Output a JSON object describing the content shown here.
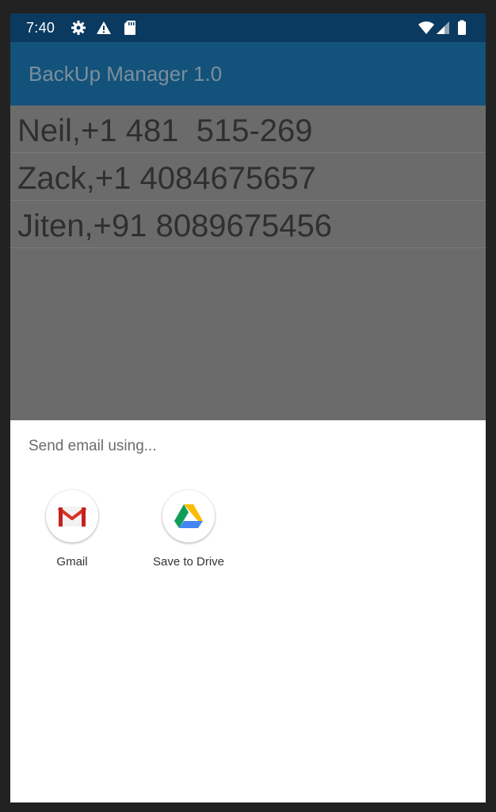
{
  "status_bar": {
    "time": "7:40",
    "icons_left": [
      "settings-gear-icon",
      "warning-icon",
      "sd-card-icon"
    ],
    "icons_right": [
      "wifi-icon",
      "cell-signal-icon",
      "battery-icon"
    ],
    "background": "#0a3a60"
  },
  "app_bar": {
    "title": "BackUp Manager 1.0",
    "background": "#13527a"
  },
  "contacts": [
    {
      "text": "Neil,+1 481  515-269"
    },
    {
      "text": "Zack,+1 4084675657"
    },
    {
      "text": "Jiten,+91 8089675456"
    }
  ],
  "share_sheet": {
    "title": "Send email using...",
    "targets": [
      {
        "label": "Gmail",
        "icon": "gmail-icon"
      },
      {
        "label": "Save to Drive",
        "icon": "google-drive-icon"
      }
    ]
  }
}
